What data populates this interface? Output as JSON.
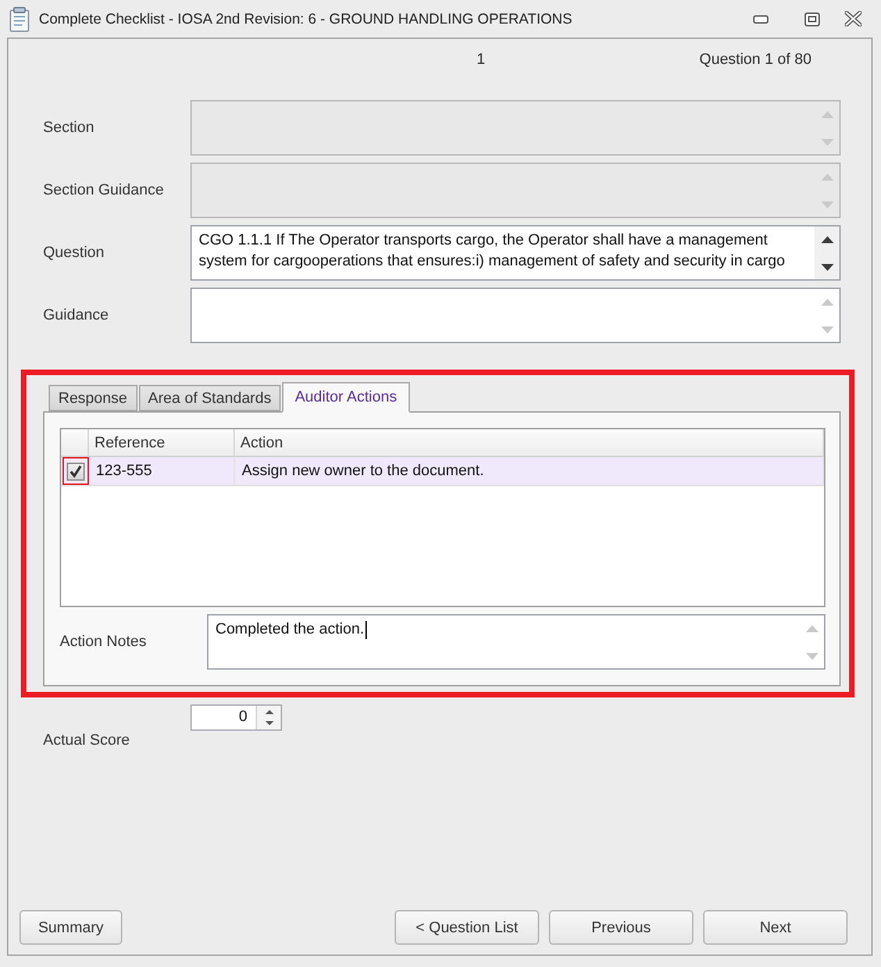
{
  "window": {
    "title": "Complete Checklist - IOSA 2nd Revision: 6 - GROUND HANDLING OPERATIONS"
  },
  "header": {
    "page": "1",
    "position": "Question 1 of 80"
  },
  "fields": [
    {
      "label": "Section",
      "disabled": true,
      "scrollable": false
    },
    {
      "label": "Section Guidance",
      "disabled": true,
      "scrollable": false
    },
    {
      "label": "Question",
      "disabled": false,
      "scrollable": true,
      "value": "CGO 1.1.1 If The Operator transports cargo, the Operator shall have a management\nsystem for cargooperations that ensures:i) management of safety and security in cargo"
    },
    {
      "label": "Guidance",
      "disabled": false,
      "scrollable": false
    }
  ],
  "tab_panel": {
    "highlighted": true,
    "tabs": [
      {
        "label": "Response",
        "selected": false
      },
      {
        "label": "Area of Standards",
        "selected": false
      },
      {
        "label": "Auditor Actions",
        "selected": true
      }
    ],
    "grid": {
      "columns": [
        "Reference",
        "Action"
      ],
      "rows": [
        {
          "checked": true,
          "focused": true,
          "selected": true,
          "cells": [
            "123-555",
            "Assign new owner to the document."
          ]
        }
      ]
    },
    "action_notes": {
      "label": "Action Notes",
      "value": "Completed the action.",
      "focused": true
    }
  },
  "actual_score": {
    "label": "Actual Score",
    "value": "0"
  },
  "footer": {
    "left_buttons": [
      "Summary"
    ],
    "right_buttons": [
      "< Question List",
      "Previous",
      "Next"
    ]
  }
}
